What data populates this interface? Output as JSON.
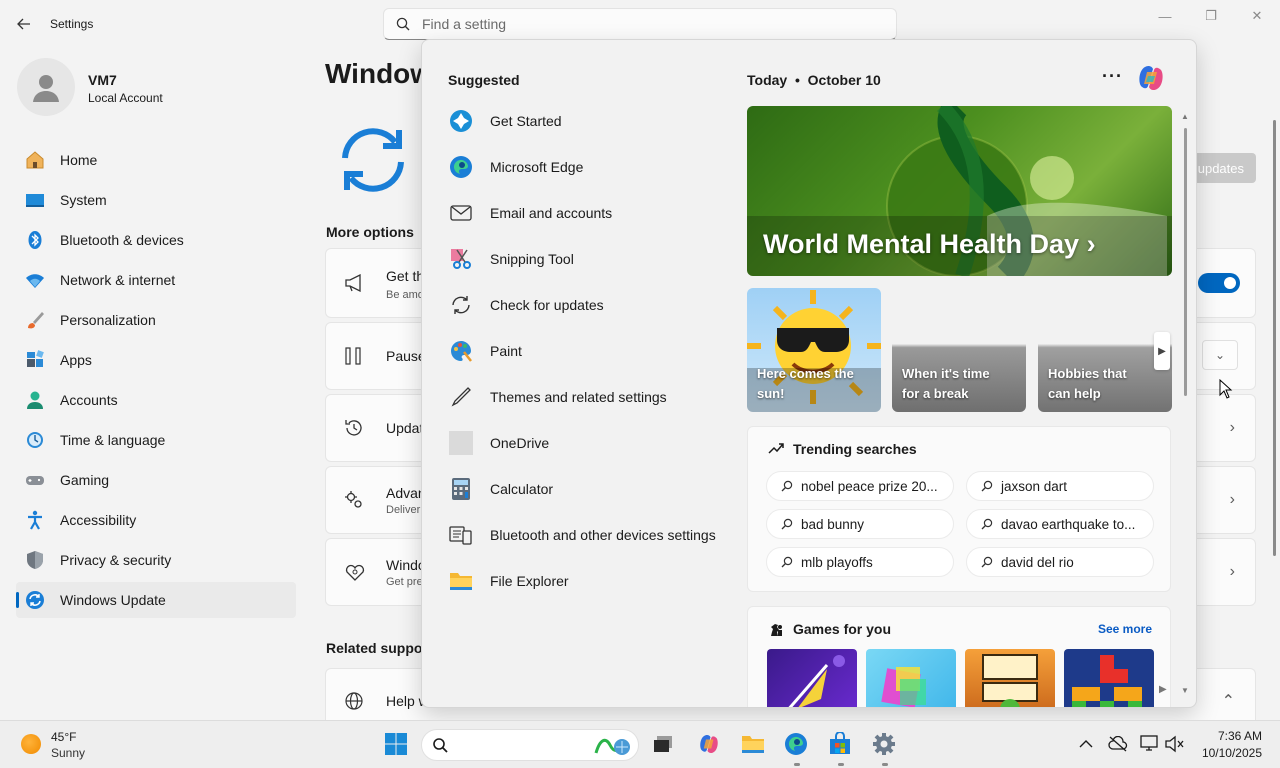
{
  "window": {
    "title": "Settings",
    "minimize": "—",
    "maximize": "❐",
    "close": "✕"
  },
  "search": {
    "placeholder": "Find a setting"
  },
  "user": {
    "name": "VM7",
    "account_type": "Local Account"
  },
  "nav": {
    "items": [
      {
        "label": "Home",
        "icon": "home-icon"
      },
      {
        "label": "System",
        "icon": "system-icon"
      },
      {
        "label": "Bluetooth & devices",
        "icon": "bluetooth-icon"
      },
      {
        "label": "Network & internet",
        "icon": "wifi-icon"
      },
      {
        "label": "Personalization",
        "icon": "brush-icon"
      },
      {
        "label": "Apps",
        "icon": "apps-icon"
      },
      {
        "label": "Accounts",
        "icon": "accounts-icon"
      },
      {
        "label": "Time & language",
        "icon": "clock-icon"
      },
      {
        "label": "Gaming",
        "icon": "gamepad-icon"
      },
      {
        "label": "Accessibility",
        "icon": "accessibility-icon"
      },
      {
        "label": "Privacy & security",
        "icon": "shield-icon"
      },
      {
        "label": "Windows Update",
        "icon": "update-icon",
        "active": true
      }
    ]
  },
  "main": {
    "heading": "Window",
    "check_button": "updates",
    "more_options": "More options",
    "cards": [
      {
        "title": "Get th",
        "subtitle": "Be amo"
      },
      {
        "title": "Pause"
      },
      {
        "title": "Updat"
      },
      {
        "title": "Advan",
        "subtitle": "Deliver"
      },
      {
        "title": "Windo",
        "subtitle": "Get pre"
      }
    ],
    "related_support": "Related suppor",
    "help_card": "Help w"
  },
  "flyout": {
    "suggested_label": "Suggested",
    "suggested": [
      {
        "label": "Get Started",
        "icon": "get-started-icon"
      },
      {
        "label": "Microsoft Edge",
        "icon": "edge-icon"
      },
      {
        "label": "Email and accounts",
        "icon": "mail-icon"
      },
      {
        "label": "Snipping Tool",
        "icon": "snipping-tool-icon"
      },
      {
        "label": "Check for updates",
        "icon": "refresh-icon"
      },
      {
        "label": "Paint",
        "icon": "paint-icon"
      },
      {
        "label": "Themes and related settings",
        "icon": "pen-icon"
      },
      {
        "label": "OneDrive",
        "icon": "onedrive-icon"
      },
      {
        "label": "Calculator",
        "icon": "calculator-icon"
      },
      {
        "label": "Bluetooth and other devices settings",
        "icon": "devices-icon"
      },
      {
        "label": "File Explorer",
        "icon": "folder-icon"
      }
    ],
    "today_label": "Today",
    "date_label": "October 10",
    "more_menu": "···",
    "hero_title": "World Mental Health Day",
    "tiles": [
      {
        "label_1": "Here comes the",
        "label_2": "sun!"
      },
      {
        "label_1": "When it's time",
        "label_2": "for a break"
      },
      {
        "label_1": "Hobbies that",
        "label_2": "can help"
      }
    ],
    "trending_title": "Trending searches",
    "trending": [
      "nobel peace prize 20...",
      "jaxson dart",
      "bad bunny",
      "davao earthquake to...",
      "mlb playoffs",
      "david del rio"
    ],
    "games_title": "Games for you",
    "see_more": "See more"
  },
  "taskbar": {
    "weather_temp": "45°F",
    "weather_cond": "Sunny",
    "time": "7:36 AM",
    "date": "10/10/2025"
  },
  "colors": {
    "accent": "#0067c0",
    "link": "#0a5bc4"
  }
}
